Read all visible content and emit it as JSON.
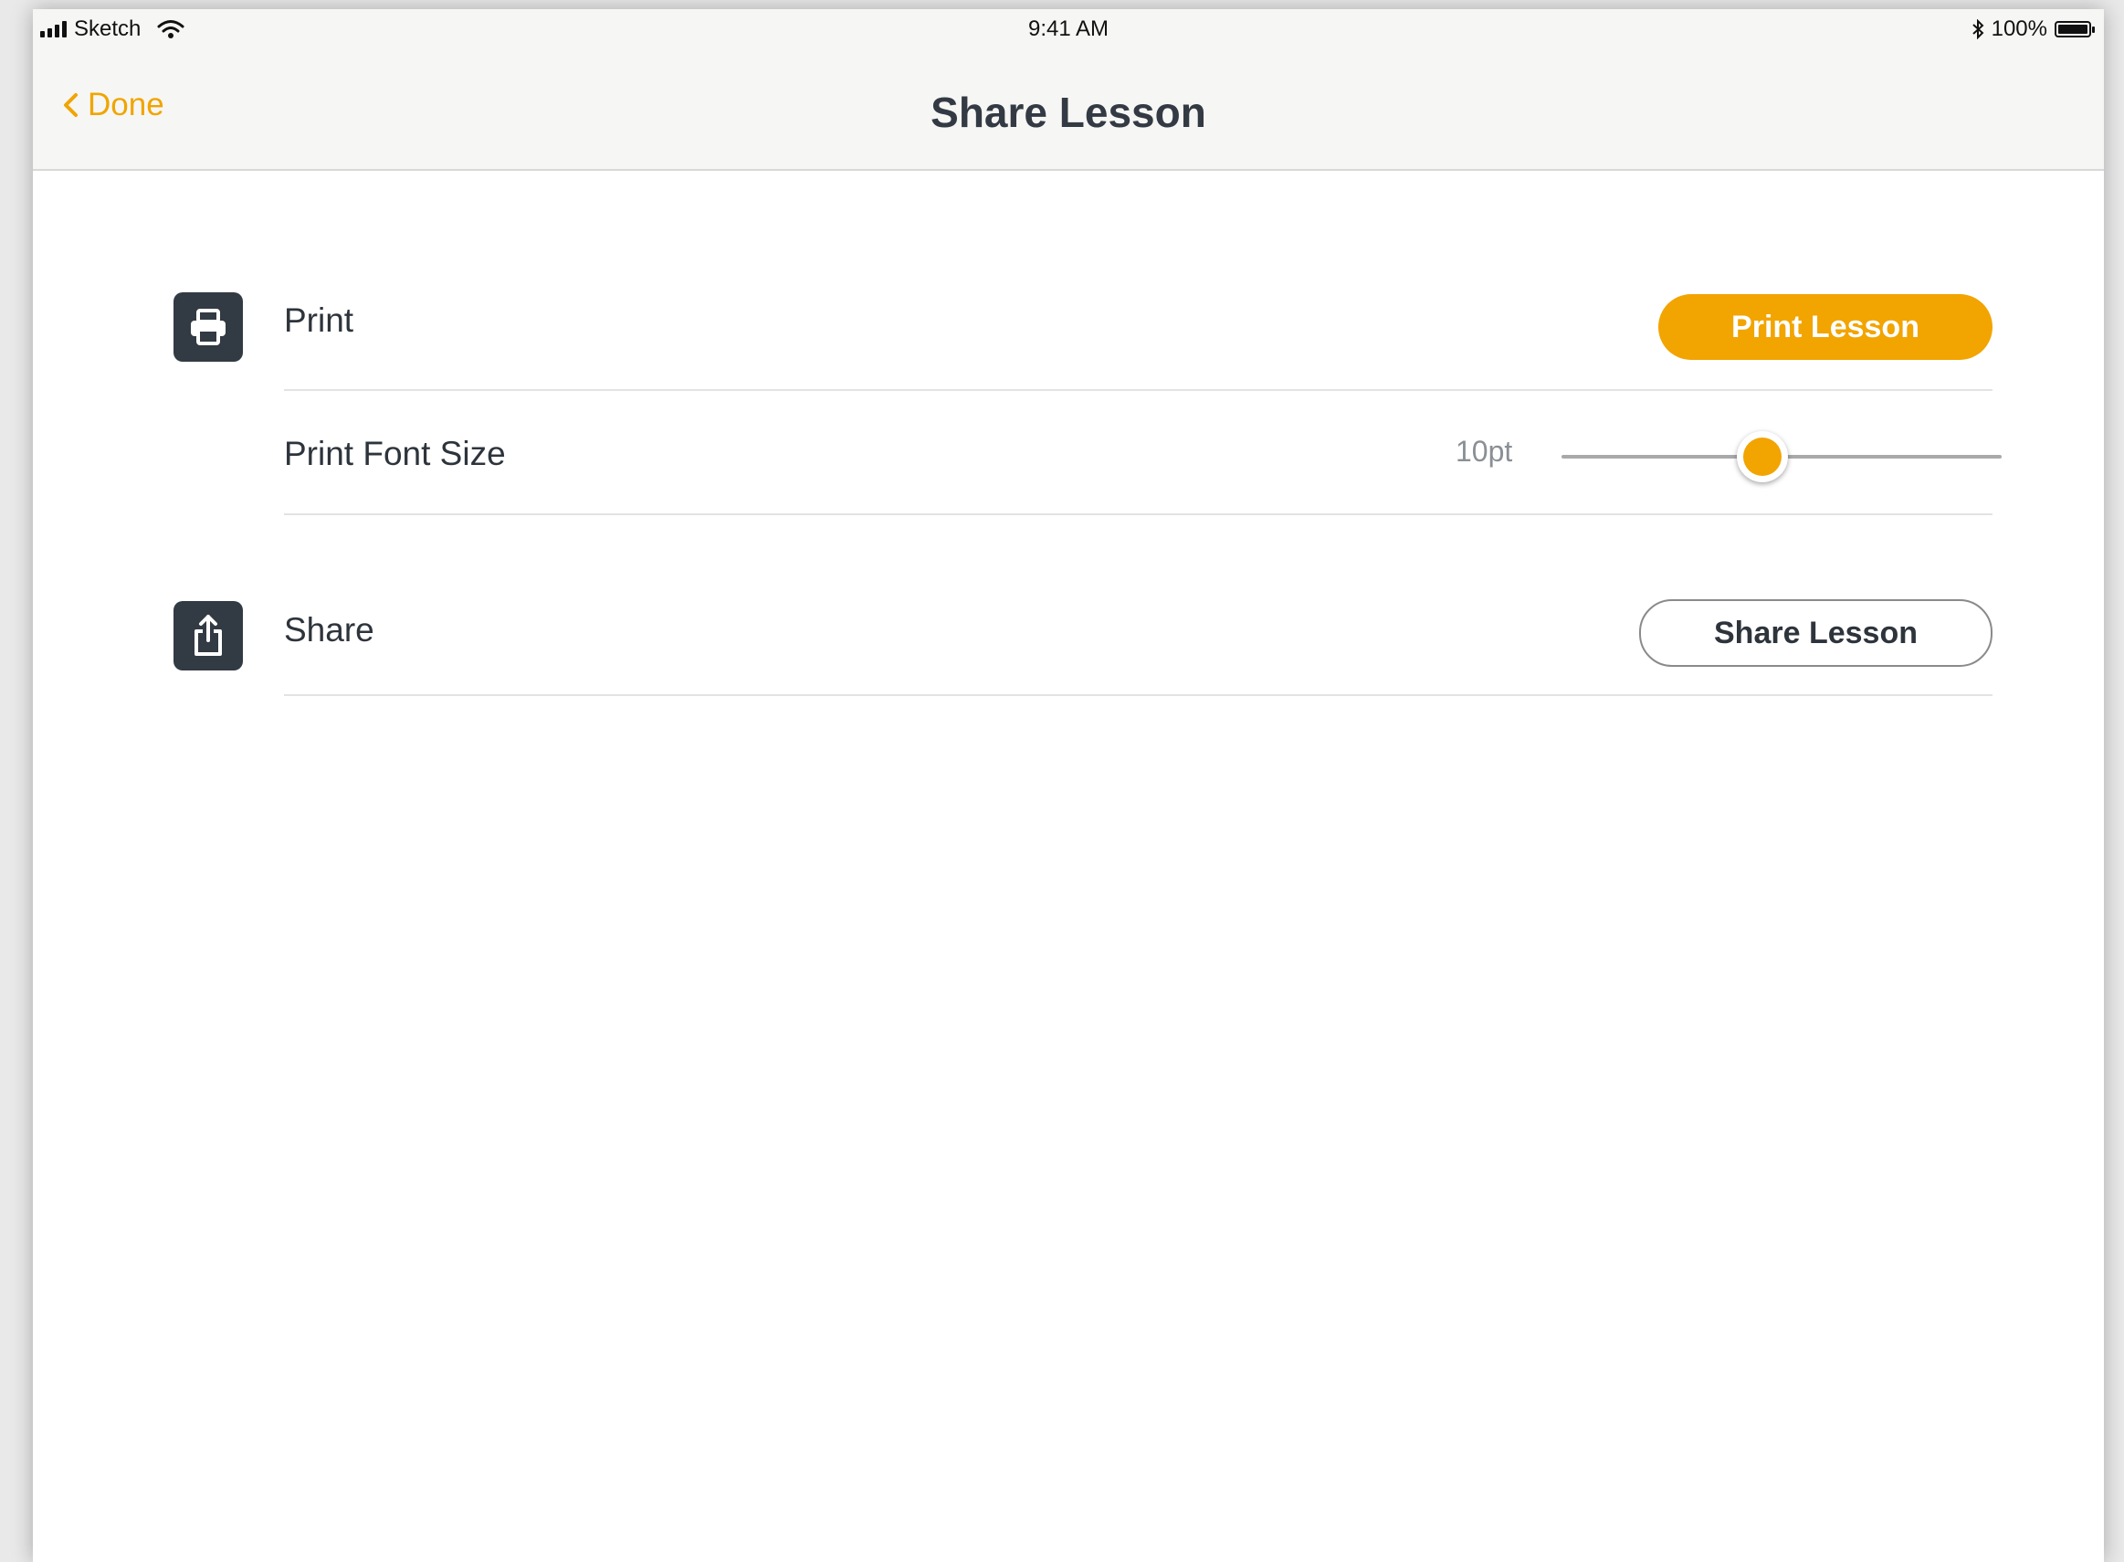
{
  "status_bar": {
    "carrier": "Sketch",
    "time": "9:41 AM",
    "battery": "100%"
  },
  "nav": {
    "back_label": "Done",
    "title": "Share Lesson"
  },
  "print_section": {
    "label": "Print",
    "button_label": "Print Lesson",
    "icon": "printer-icon"
  },
  "font_size": {
    "label": "Print Font Size",
    "value_text": "10pt",
    "slider_fraction": 0.45
  },
  "share_section": {
    "label": "Share",
    "button_label": "Share Lesson",
    "icon": "share-icon"
  },
  "colors": {
    "accent": "#f2a400",
    "icon_bg": "#323a44",
    "text": "#2e343c"
  }
}
